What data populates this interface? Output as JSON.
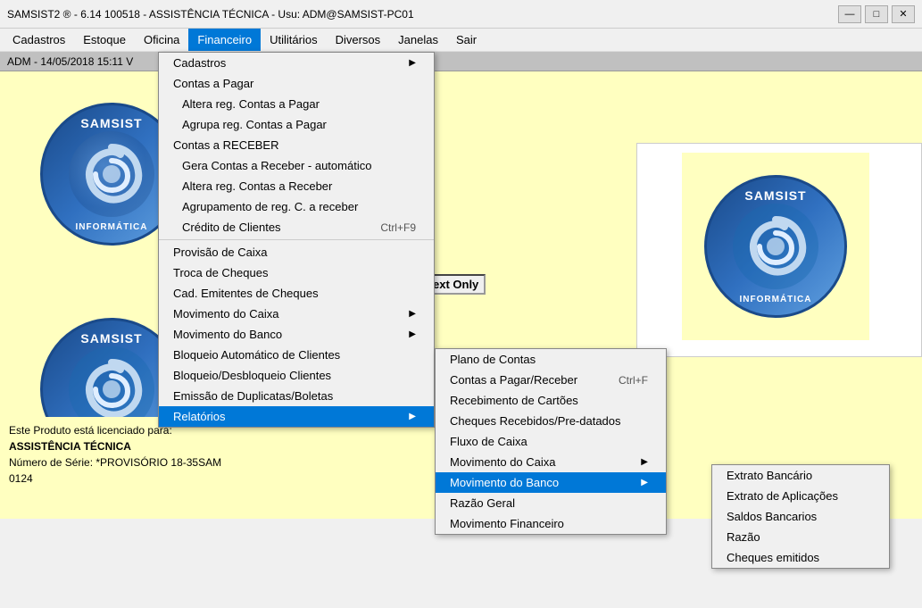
{
  "titlebar": {
    "text": "SAMSIST2 ® - 6.14  100518 - ASSISTÊNCIA TÉCNICA - Usu: ADM@SAMSIST-PC01",
    "controls": {
      "minimize": "—",
      "maximize": "□",
      "close": "✕"
    }
  },
  "menubar": {
    "items": [
      {
        "id": "cadastros",
        "label": "Cadastros"
      },
      {
        "id": "estoque",
        "label": "Estoque"
      },
      {
        "id": "oficina",
        "label": "Oficina"
      },
      {
        "id": "financeiro",
        "label": "Financeiro",
        "active": true
      },
      {
        "id": "utilitarios",
        "label": "Utilitários"
      },
      {
        "id": "diversos",
        "label": "Diversos"
      },
      {
        "id": "janelas",
        "label": "Janelas"
      },
      {
        "id": "sair",
        "label": "Sair"
      }
    ]
  },
  "adm_bar": {
    "text": "ADM - 14/05/2018  15:11  V"
  },
  "text_only_badge": "ext Only",
  "financeiro_menu": {
    "items": [
      {
        "id": "cadastros-sub",
        "label": "Cadastros",
        "has_arrow": true,
        "type": "item"
      },
      {
        "id": "contas-pagar",
        "label": "Contas a Pagar",
        "type": "header"
      },
      {
        "id": "altera-contas-pagar",
        "label": "Altera reg. Contas a Pagar",
        "type": "sub-item"
      },
      {
        "id": "agrupa-contas-pagar",
        "label": "Agrupa reg. Contas a Pagar",
        "type": "sub-item"
      },
      {
        "id": "contas-receber",
        "label": "Contas a RECEBER",
        "type": "header"
      },
      {
        "id": "gera-contas-receber",
        "label": "Gera Contas a Receber - automático",
        "type": "sub-item"
      },
      {
        "id": "altera-contas-receber",
        "label": "Altera reg. Contas a Receber",
        "type": "sub-item"
      },
      {
        "id": "agrupamento-reg",
        "label": "Agrupamento de reg. C. a receber",
        "type": "sub-item"
      },
      {
        "id": "credito-clientes",
        "label": "Crédito de Clientes",
        "shortcut": "Ctrl+F9",
        "type": "sub-item"
      },
      {
        "id": "sep1",
        "type": "separator"
      },
      {
        "id": "provisao-caixa",
        "label": "Provisão de Caixa",
        "type": "item"
      },
      {
        "id": "troca-cheques",
        "label": "Troca de Cheques",
        "type": "item"
      },
      {
        "id": "cad-emitentes",
        "label": "Cad. Emitentes de Cheques",
        "type": "item"
      },
      {
        "id": "movimento-caixa",
        "label": "Movimento do Caixa",
        "has_arrow": true,
        "type": "item"
      },
      {
        "id": "movimento-banco",
        "label": "Movimento do Banco",
        "has_arrow": true,
        "type": "item"
      },
      {
        "id": "bloqueio-auto",
        "label": "Bloqueio Automático de Clientes",
        "type": "item"
      },
      {
        "id": "bloqueio-des",
        "label": "Bloqueio/Desbloqueio Clientes",
        "type": "item"
      },
      {
        "id": "emissao-dup",
        "label": "Emissão de Duplicatas/Boletas",
        "type": "item"
      },
      {
        "id": "relatorios",
        "label": "Relatórios",
        "has_arrow": true,
        "type": "item",
        "highlighted": true
      }
    ]
  },
  "relatorios_submenu": {
    "items": [
      {
        "id": "plano-contas",
        "label": "Plano de Contas"
      },
      {
        "id": "contas-pagar-receber",
        "label": "Contas a Pagar/Receber",
        "shortcut": "Ctrl+F"
      },
      {
        "id": "recebimento-cartoes",
        "label": "Recebimento de Cartões"
      },
      {
        "id": "cheques-recebidos",
        "label": "Cheques Recebidos/Pre-datados"
      },
      {
        "id": "fluxo-caixa",
        "label": "Fluxo de Caixa"
      },
      {
        "id": "mov-caixa-rel",
        "label": "Movimento do Caixa",
        "has_arrow": true
      },
      {
        "id": "mov-banco-rel",
        "label": "Movimento do Banco",
        "has_arrow": true,
        "highlighted": true
      },
      {
        "id": "razao-geral",
        "label": "Razão Geral"
      },
      {
        "id": "mov-financeiro",
        "label": "Movimento Financeiro"
      }
    ]
  },
  "banco_submenu": {
    "items": [
      {
        "id": "extrato-bancario",
        "label": "Extrato Bancário"
      },
      {
        "id": "extrato-aplicacoes",
        "label": "Extrato de Aplicações"
      },
      {
        "id": "saldos-bancarios",
        "label": "Saldos Bancarios"
      },
      {
        "id": "razao",
        "label": "Razão"
      },
      {
        "id": "cheques-emitidos",
        "label": "Cheques emitidos"
      }
    ]
  },
  "bottom_info": {
    "line1": "Este Produto está licenciado para:",
    "line2": "ASSISTÊNCIA TÉCNICA",
    "line3": "Número de Série: *PROVISÓRIO 18-35SAM    0124"
  },
  "logos": {
    "top_text": "SAMSIST",
    "bottom_text": "INFORMÁTICA"
  }
}
